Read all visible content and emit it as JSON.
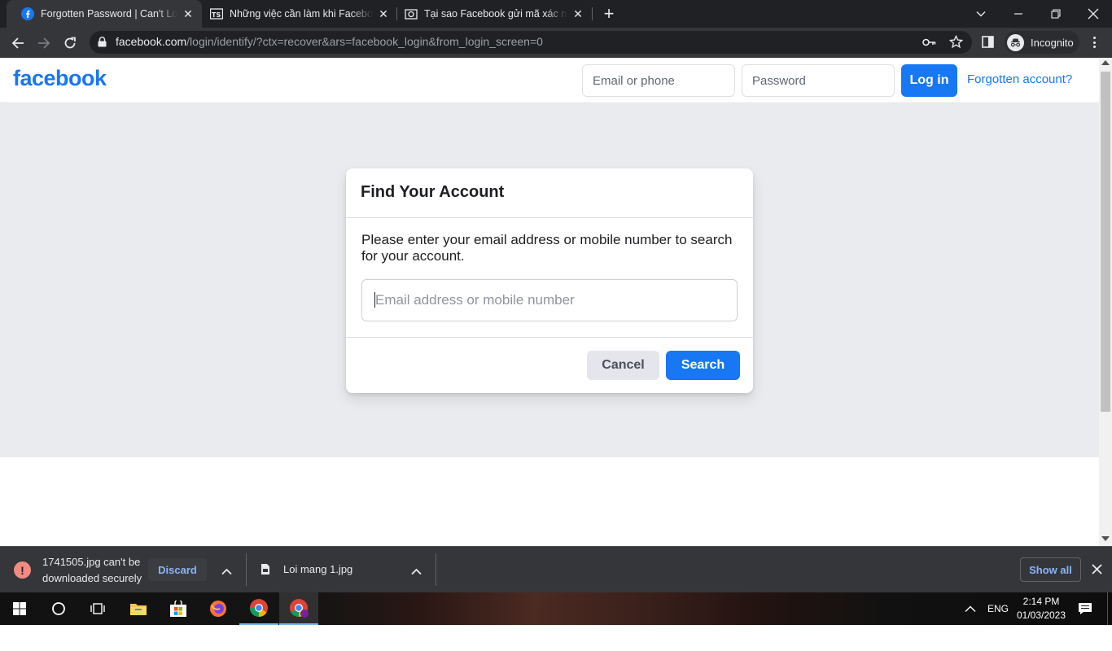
{
  "browser": {
    "tabs": [
      {
        "title": "Forgotten Password | Can't Log In",
        "favicon": "facebook-icon",
        "active": true
      },
      {
        "title": "Những việc cần làm khi Facebook",
        "favicon": "tsl-icon",
        "active": false
      },
      {
        "title": "Tại sao Facebook gửi mã xác nhận",
        "favicon": "camera-icon",
        "active": false
      }
    ],
    "new_tab_symbol": "+",
    "url_host": "facebook.com",
    "url_path": "/login/identify/?ctx=recover&ars=facebook_login&from_login_screen=0",
    "profile_label": "Incognito"
  },
  "header": {
    "logo": "facebook",
    "email_placeholder": "Email or phone",
    "password_placeholder": "Password",
    "login_label": "Log in",
    "forgot_link": "Forgotten account?"
  },
  "card": {
    "title": "Find Your Account",
    "description": "Please enter your email address or mobile number to search for your account.",
    "input_placeholder": "Email address or mobile number",
    "cancel_label": "Cancel",
    "search_label": "Search"
  },
  "downloads": {
    "item1_line1": "1741505.jpg can't be",
    "item1_line2": "downloaded securely",
    "discard_label": "Discard",
    "item2_name": "Loi mang 1.jpg",
    "show_all_label": "Show all"
  },
  "taskbar": {
    "language": "ENG",
    "time": "2:14 PM",
    "date": "01/03/2023"
  },
  "colors": {
    "facebook_blue": "#1877f2",
    "page_gray": "#e9ebee",
    "chrome_dark": "#202124"
  }
}
